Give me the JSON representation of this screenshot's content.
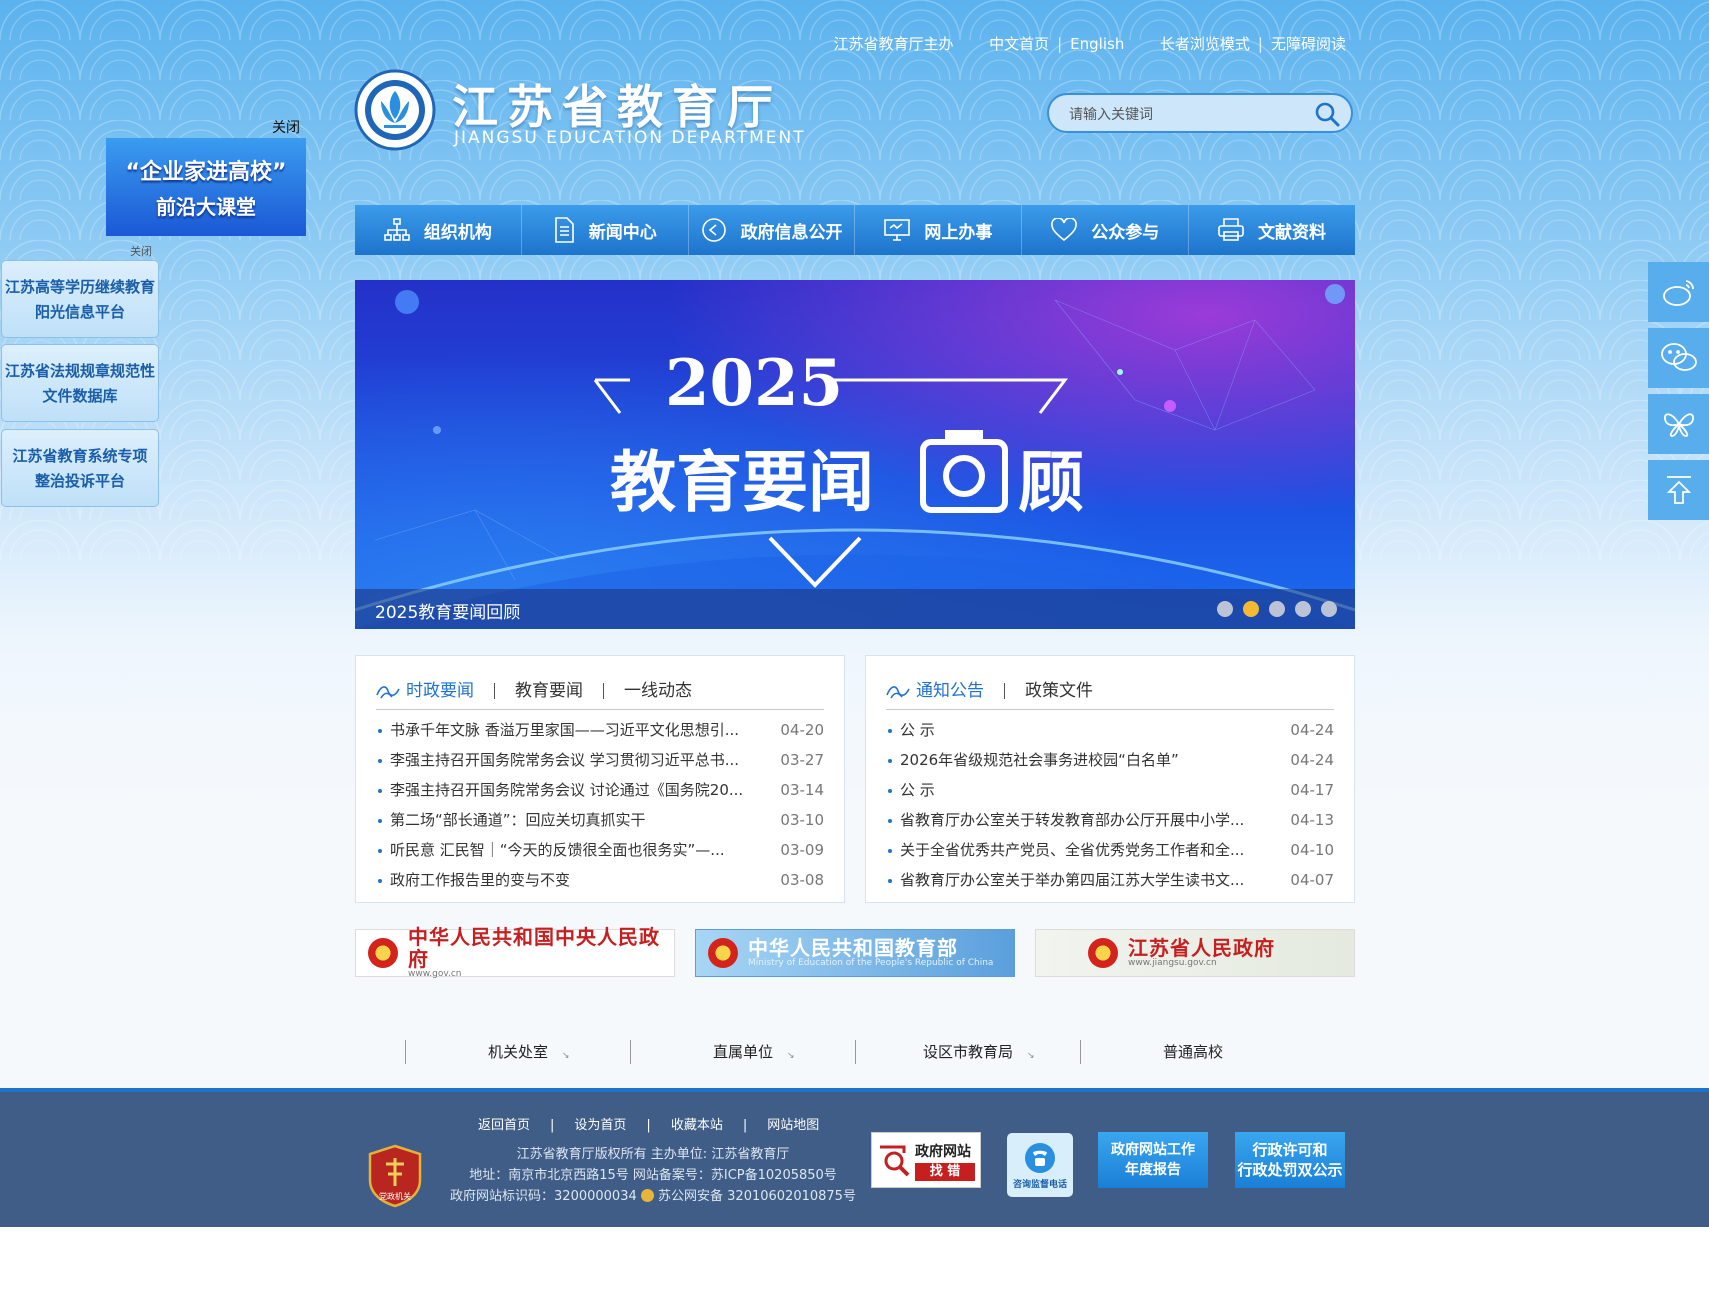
{
  "top_links": {
    "host": "江苏省教育厅主办",
    "home_cn": "中文首页",
    "english": "English",
    "elder_mode": "长者浏览模式",
    "accessibility": "无障碍阅读"
  },
  "logo": {
    "title": "江苏省教育厅",
    "subtitle": "JIANGSU EDUCATION DEPARTMENT",
    "icon": "jiangsu-education-emblem"
  },
  "search": {
    "placeholder": "请输入关键词",
    "icon": "search-icon"
  },
  "nav": [
    {
      "label": "组织机构",
      "icon": "org-chart-icon"
    },
    {
      "label": "新闻中心",
      "icon": "document-icon"
    },
    {
      "label": "政府信息公开",
      "icon": "play-circle-icon"
    },
    {
      "label": "网上办事",
      "icon": "monitor-icon"
    },
    {
      "label": "公众参与",
      "icon": "heart-icon"
    },
    {
      "label": "文献资料",
      "icon": "printer-icon"
    }
  ],
  "banner": {
    "year": "2025",
    "headline_a": "教育要闻",
    "headline_b": "顾",
    "caption": "2025教育要闻回顾",
    "slide_count": 5,
    "active_slide": 2
  },
  "news_left": {
    "tabs": [
      "时政要闻",
      "教育要闻",
      "一线动态"
    ],
    "active_tab": 0,
    "items": [
      {
        "title": "书承千年文脉 香溢万里家国——习近平文化思想引...",
        "date": "04-20"
      },
      {
        "title": "李强主持召开国务院常务会议 学习贯彻习近平总书...",
        "date": "03-27"
      },
      {
        "title": "李强主持召开国务院常务会议 讨论通过《国务院20...",
        "date": "03-14"
      },
      {
        "title": "第二场“部长通道”：回应关切真抓实干",
        "date": "03-10"
      },
      {
        "title": "听民意 汇民智｜“今天的反馈很全面也很务实”—...",
        "date": "03-09"
      },
      {
        "title": "政府工作报告里的变与不变",
        "date": "03-08"
      }
    ]
  },
  "news_right": {
    "tabs": [
      "通知公告",
      "政策文件"
    ],
    "active_tab": 0,
    "items": [
      {
        "title": "公 示",
        "date": "04-24"
      },
      {
        "title": "2026年省级规范社会事务进校园“白名单”",
        "date": "04-24"
      },
      {
        "title": "公 示",
        "date": "04-17"
      },
      {
        "title": "省教育厅办公室关于转发教育部办公厅开展中小学...",
        "date": "04-13"
      },
      {
        "title": "关于全省优秀共产党员、全省优秀党务工作者和全...",
        "date": "04-10"
      },
      {
        "title": "省教育厅办公室关于举办第四届江苏大学生读书文...",
        "date": "04-07"
      }
    ]
  },
  "gov_links": [
    {
      "name": "中华人民共和国中央人民政府",
      "url_text": "www.gov.cn"
    },
    {
      "name": "中华人民共和国教育部",
      "url_text": "Ministry of Education of the People's Republic of China"
    },
    {
      "name": "江苏省人民政府",
      "url_text": "www.jiangsu.gov.cn"
    }
  ],
  "unit_links": [
    "机关处室",
    "直属单位",
    "设区市教育局",
    "普通高校"
  ],
  "footer": {
    "links": [
      "返回首页",
      "设为首页",
      "收藏本站",
      "网站地图"
    ],
    "copyright": "江苏省教育厅版权所有 主办单位: 江苏省教育厅",
    "address": "地址：南京市北京西路15号 网站备案号：苏ICP备10205850号",
    "site_id": "政府网站标识码：3200000034",
    "police": "苏公网安备 32010602010875号",
    "badge_text": "党政机关",
    "btn_error_a": "政府网站",
    "btn_error_b": "找 错",
    "btn_hotline": "咨询监督电话",
    "btn_report": "政府网站工作年度报告",
    "btn_report_a": "政府网站工作",
    "btn_report_b": "年度报告",
    "btn_permit_a": "行政许可和",
    "btn_permit_b": "行政处罚双公示"
  },
  "left_float": {
    "close_top": "关闭",
    "promo_l1": "“企业家进高校”",
    "promo_l2": "前沿大课堂",
    "close_small": "关闭",
    "boxes": [
      {
        "l1": "江苏高等学历继续教育",
        "l2": "阳光信息平台"
      },
      {
        "l1": "江苏省法规规章规范性",
        "l2": "文件数据库"
      },
      {
        "l1": "江苏省教育系统专项",
        "l2": "整治投诉平台"
      }
    ]
  },
  "right_share": [
    "weibo-icon",
    "wechat-icon",
    "butterfly-icon",
    "back-to-top-icon"
  ],
  "colors": {
    "brand_blue": "#1d74cc",
    "footer_bg": "#3f5d86",
    "gold": "#f5b833"
  }
}
